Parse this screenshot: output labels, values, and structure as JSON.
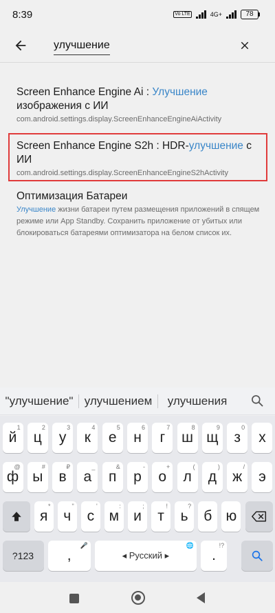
{
  "status_bar": {
    "time": "8:39",
    "volte": "Vo LTE",
    "network": "4G+",
    "battery": "78"
  },
  "search": {
    "query": "улучшение"
  },
  "results": [
    {
      "title_before": "Screen Enhance Engine Ai : ",
      "title_highlight": "Улучшение",
      "title_after": " изображения с ИИ",
      "subtitle": "com.android.settings.display.ScreenEnhanceEngineAiActivity"
    },
    {
      "title_before": "Screen Enhance Engine S2h : HDR-",
      "title_highlight": "улучшение",
      "title_after": " с ИИ",
      "subtitle": "com.android.settings.display.ScreenEnhanceEngineS2hActivity"
    },
    {
      "title": "Оптимизация Батареи",
      "subtitle_highlight": "Улучшение",
      "subtitle_rest": " жизни батареи путем размещения приложений в спящем режиме или App Standby. Сохранить приложение от убитых или блокироваться батареями оптимизатора на белом список их."
    }
  ],
  "suggestions": [
    "\"улучшение\"",
    "улучшением",
    "улучшения"
  ],
  "keyboard": {
    "row1": [
      {
        "k": "й",
        "h": "1"
      },
      {
        "k": "ц",
        "h": "2"
      },
      {
        "k": "у",
        "h": "3"
      },
      {
        "k": "к",
        "h": "4"
      },
      {
        "k": "е",
        "h": "5"
      },
      {
        "k": "н",
        "h": "6"
      },
      {
        "k": "г",
        "h": "7"
      },
      {
        "k": "ш",
        "h": "8"
      },
      {
        "k": "щ",
        "h": "9"
      },
      {
        "k": "з",
        "h": "0"
      },
      {
        "k": "х",
        "h": ""
      }
    ],
    "row2": [
      {
        "k": "ф",
        "h": "@"
      },
      {
        "k": "ы",
        "h": "#"
      },
      {
        "k": "в",
        "h": "₽"
      },
      {
        "k": "а",
        "h": "_"
      },
      {
        "k": "п",
        "h": "&"
      },
      {
        "k": "р",
        "h": "-"
      },
      {
        "k": "о",
        "h": "+"
      },
      {
        "k": "л",
        "h": "("
      },
      {
        "k": "д",
        "h": ")"
      },
      {
        "k": "ж",
        "h": "/"
      },
      {
        "k": "э",
        "h": ""
      }
    ],
    "row3": [
      {
        "k": "я",
        "h": "*"
      },
      {
        "k": "ч",
        "h": "\""
      },
      {
        "k": "с",
        "h": "'"
      },
      {
        "k": "м",
        "h": ":"
      },
      {
        "k": "и",
        "h": ";"
      },
      {
        "k": "т",
        "h": "!"
      },
      {
        "k": "ь",
        "h": "?"
      },
      {
        "k": "б",
        "h": ""
      },
      {
        "k": "ю",
        "h": ""
      }
    ],
    "symbols_label": "?123",
    "comma": ",",
    "comma_hint": "🎤",
    "space_label": "◂ Русский ▸",
    "space_hint": "🌐",
    "period": ".",
    "period_hint": "!?"
  }
}
